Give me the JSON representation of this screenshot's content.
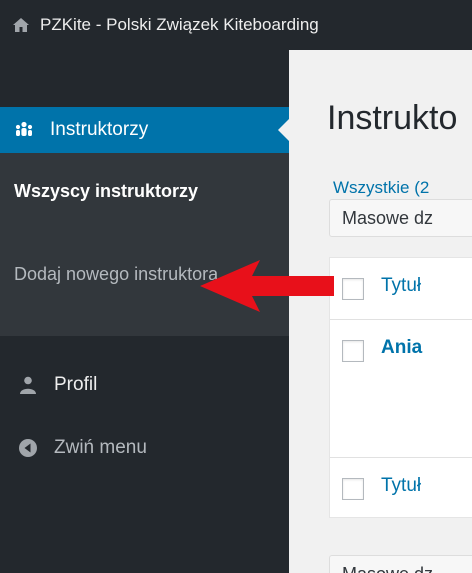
{
  "adminbar": {
    "site_title": "PZKite - Polski Związek Kiteboarding"
  },
  "sidebar": {
    "current_menu": "Instruktorzy",
    "submenu": {
      "all_instructors": "Wszyscy instruktorzy",
      "add_instructor": "Dodaj nowego instruktora"
    },
    "profile": "Profil",
    "collapse": "Zwiń menu"
  },
  "main": {
    "page_title": "Instrukto",
    "views": "Wszystkie (2",
    "bulk_actions_top": "Masowe dz",
    "bulk_actions_bottom": "Masowe dz",
    "table": {
      "header_title": "Tytuł",
      "rows": [
        {
          "title": "Ania"
        }
      ],
      "footer_title": "Tytuł"
    }
  },
  "colors": {
    "admin_dark": "#23282d",
    "submenu_bg": "#32373c",
    "accent_blue": "#0073aa",
    "content_bg": "#f1f1f1",
    "annotation_arrow": "#e8101a"
  }
}
